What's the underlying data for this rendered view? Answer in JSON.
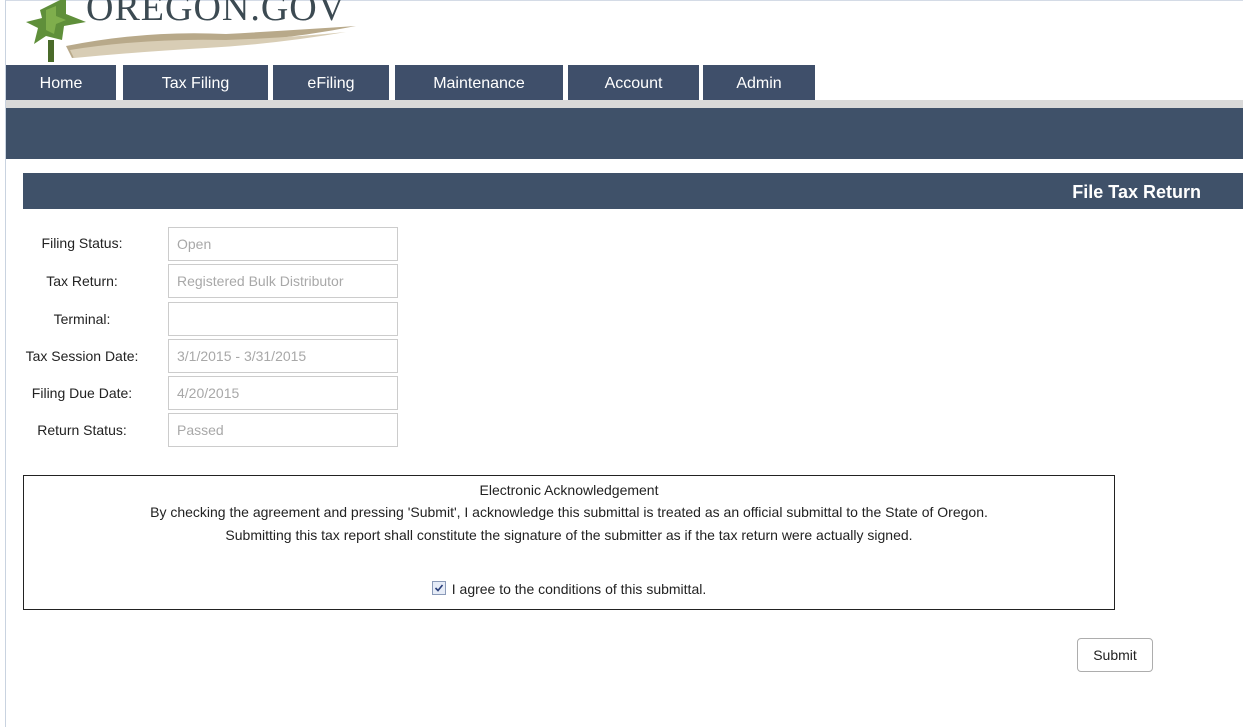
{
  "logo": {
    "text": "OREGON.GOV"
  },
  "nav": {
    "tabs": [
      {
        "label": "Home"
      },
      {
        "label": "Tax Filing"
      },
      {
        "label": "eFiling"
      },
      {
        "label": "Maintenance"
      },
      {
        "label": "Account"
      },
      {
        "label": "Admin"
      }
    ]
  },
  "section": {
    "title": "File Tax Return"
  },
  "form": {
    "fields": [
      {
        "label": "Filing Status:",
        "value": "Open"
      },
      {
        "label": "Tax Return:",
        "value": "Registered Bulk Distributor"
      },
      {
        "label": "Terminal:",
        "value": ""
      },
      {
        "label": "Tax Session Date:",
        "value": "3/1/2015 - 3/31/2015"
      },
      {
        "label": "Filing Due Date:",
        "value": "4/20/2015"
      },
      {
        "label": "Return Status:",
        "value": "Passed"
      }
    ]
  },
  "acknowledgement": {
    "title": "Electronic Acknowledgement",
    "line1": "By checking the agreement and pressing 'Submit', I acknowledge this submittal is treated as an official submittal to the State of Oregon.",
    "line2": "Submitting this tax report shall constitute the signature of the submitter as if the tax return were actually signed.",
    "agree_label": "I agree to the conditions of this submittal.",
    "agree_checked": true
  },
  "submit_label": "Submit",
  "colors": {
    "nav": "#3f4f6a",
    "header_bar": "#3f5169",
    "input_text": "#a8a8a8"
  }
}
